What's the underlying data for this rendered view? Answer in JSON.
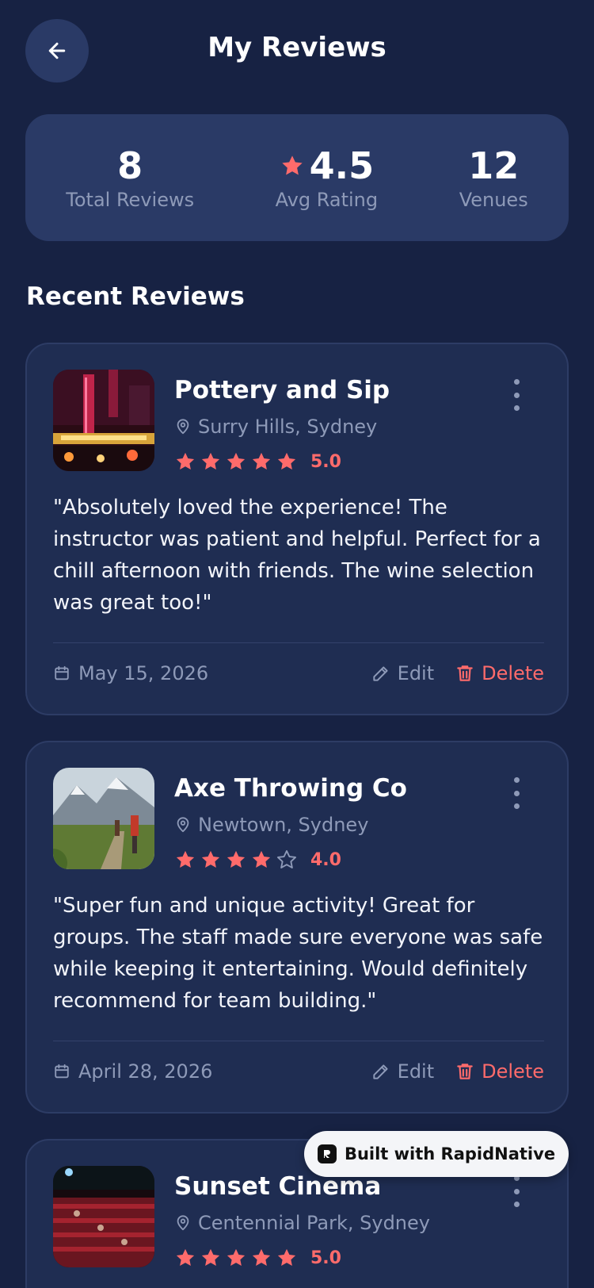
{
  "header": {
    "title": "My Reviews"
  },
  "stats": [
    {
      "value": "8",
      "label": "Total Reviews"
    },
    {
      "value": "4.5",
      "label": "Avg Rating"
    },
    {
      "value": "12",
      "label": "Venues"
    }
  ],
  "section_title": "Recent Reviews",
  "reviews": [
    {
      "name": "Pottery and Sip",
      "location": "Surry Hills, Sydney",
      "stars": 5,
      "rating": "5.0",
      "text": "\"Absolutely loved the experience! The instructor was patient and helpful. Perfect for a chill afternoon with friends. The wine selection was great too!\"",
      "date": "May 15, 2026",
      "edit_label": "Edit",
      "delete_label": "Delete"
    },
    {
      "name": "Axe Throwing Co",
      "location": "Newtown, Sydney",
      "stars": 4,
      "rating": "4.0",
      "text": "\"Super fun and unique activity! Great for groups. The staff made sure everyone was safe while keeping it entertaining. Would definitely recommend for team building.\"",
      "date": "April 28, 2026",
      "edit_label": "Edit",
      "delete_label": "Delete"
    },
    {
      "name": "Sunset Cinema",
      "location": "Centennial Park, Sydney",
      "stars": 5,
      "rating": "5.0"
    }
  ],
  "badge": {
    "label": "Built with RapidNative"
  },
  "colors": {
    "background": "#172243",
    "card": "#1f2d52",
    "accent": "#ff6b6b",
    "muted": "#8e9ab8"
  }
}
